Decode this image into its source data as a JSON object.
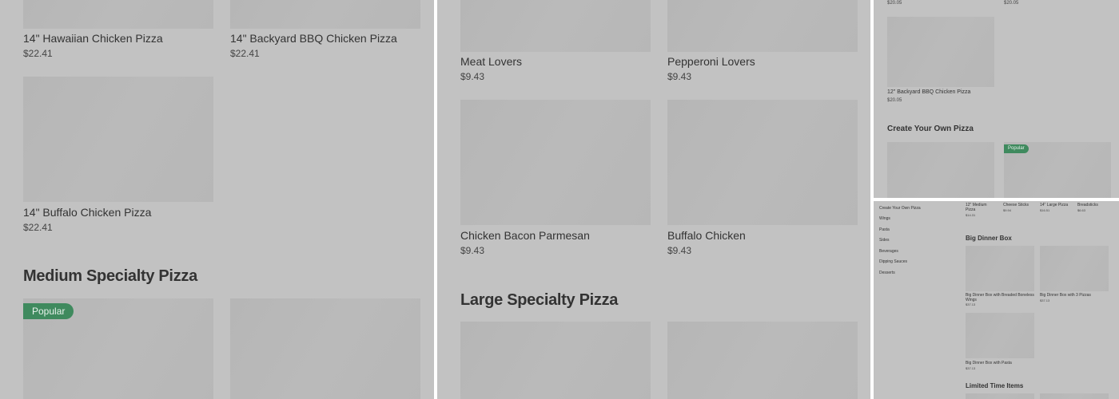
{
  "panel1": {
    "items": [
      {
        "name": "14\" Hawaiian Chicken Pizza",
        "price": "$22.41"
      },
      {
        "name": "14\" Backyard BBQ Chicken Pizza",
        "price": "$22.41"
      },
      {
        "name": "14\" Buffalo Chicken Pizza",
        "price": "$22.41"
      }
    ],
    "section_title": "Medium Specialty Pizza",
    "badge": "Popular"
  },
  "panel2": {
    "items": [
      {
        "name": "Meat Lovers",
        "price": "$9.43"
      },
      {
        "name": "Pepperoni Lovers",
        "price": "$9.43"
      },
      {
        "name": "Chicken Bacon Parmesan",
        "price": "$9.43"
      },
      {
        "name": "Buffalo Chicken",
        "price": "$9.43"
      }
    ],
    "section_title": "Large Specialty Pizza"
  },
  "panel3": {
    "top_prices": [
      "$20.05",
      "$20.05"
    ],
    "item": {
      "name": "12\" Backyard BBQ Chicken Pizza",
      "price": "$20.05"
    },
    "section_title": "Create Your Own Pizza",
    "badge": "Popular"
  },
  "panel4": {
    "nav": [
      "Create Your Own Pizza",
      "Wings",
      "Pasta",
      "Sides",
      "Beverages",
      "Dipping Sauces",
      "Desserts"
    ],
    "top_items": [
      {
        "name": "12\" Medium Pizza",
        "price": "$14.31"
      },
      {
        "name": "Cheese Sticks",
        "price": "$9.94"
      },
      {
        "name": "14\" Large Pizza",
        "price": "$16.51"
      },
      {
        "name": "Breadsticks",
        "price": "$6.63"
      }
    ],
    "section_title": "Big Dinner Box",
    "items": [
      {
        "name": "Big Dinner Box with Breaded Boneless Wings",
        "price": "$37.13"
      },
      {
        "name": "Big Dinner Box with 3 Pizzas",
        "price": "$37.13"
      },
      {
        "name": "Big Dinner Box with Pasta",
        "price": "$37.13"
      }
    ],
    "section_title_2": "Limited Time Items"
  }
}
